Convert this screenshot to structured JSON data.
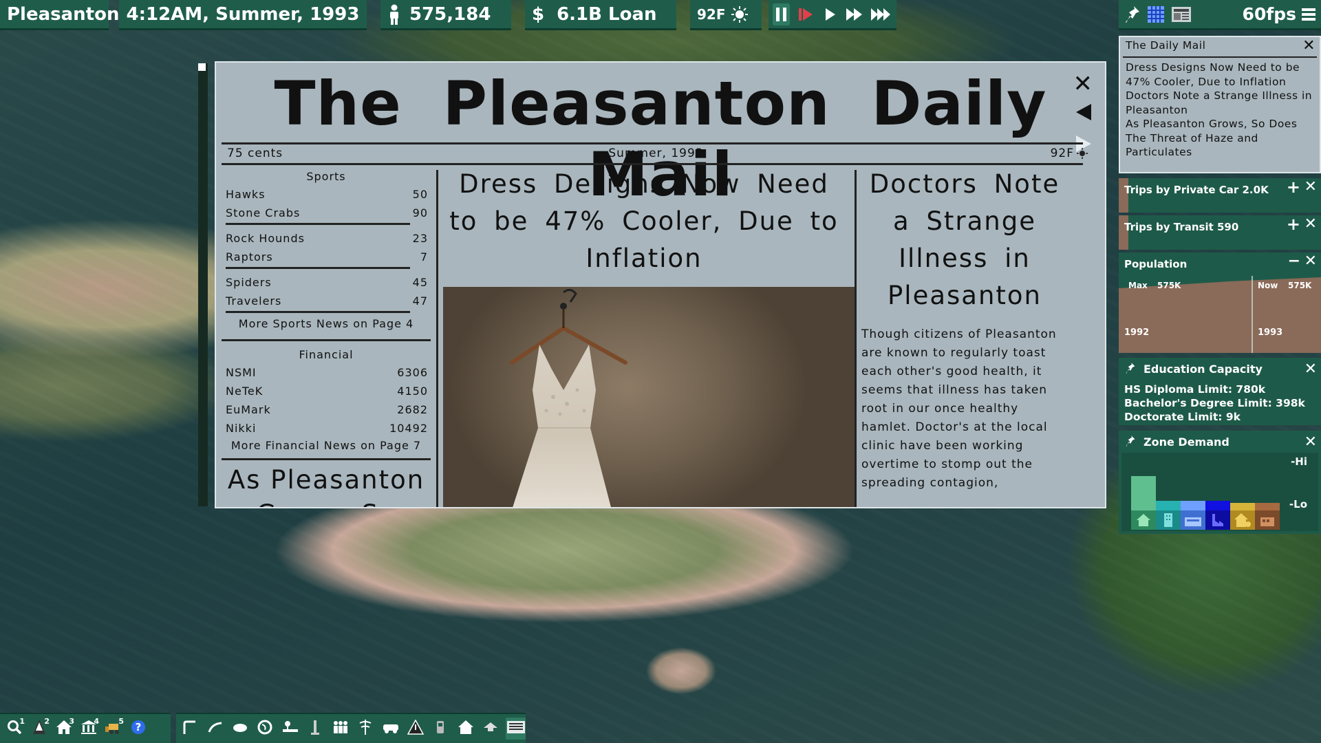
{
  "hud": {
    "city": "Pleasanton",
    "time": "4:12AM, Summer, 1993",
    "population": "575,184",
    "money_symbol": "$",
    "money": "6.1B Loan",
    "temperature": "92F",
    "fps": "60fps"
  },
  "newspaper": {
    "masthead": "The Pleasanton Daily Mail",
    "price": "75 cents",
    "date": "Summer, 1993",
    "temperature": "92F",
    "sports": {
      "title": "Sports",
      "games": [
        {
          "team": "Hawks",
          "score": "50"
        },
        {
          "team": "Stone Crabs",
          "score": "90"
        },
        {
          "team": "Rock Hounds",
          "score": "23"
        },
        {
          "team": "Raptors",
          "score": "7"
        },
        {
          "team": "Spiders",
          "score": "45"
        },
        {
          "team": "Travelers",
          "score": "47"
        }
      ],
      "more": "More Sports News on Page 4"
    },
    "financial": {
      "title": "Financial",
      "stocks": [
        {
          "name": "NSMI",
          "value": "6306"
        },
        {
          "name": "NeTeK",
          "value": "4150"
        },
        {
          "name": "EuMark",
          "value": "2682"
        },
        {
          "name": "Nikki",
          "value": "10492"
        }
      ],
      "more": "More Financial News on Page 7"
    },
    "teaser": "As Pleasanton Grows, So",
    "headline_main": "Dress Designs Now Need to be 47% Cooler, Due to Inflation",
    "headline_right": "Doctors Note a Strange Illness in Pleasanton",
    "story_right": "Though citizens of Pleasanton are known to regularly toast each other's good health, it seems that illness has taken root in our once healthy hamlet. Doctor's at the local clinic have been working overtime to stomp out the spreading contagion,"
  },
  "panels": {
    "mail": {
      "title": "The Daily Mail",
      "items": [
        "Dress Designs Now Need to be 47% Cooler, Due to Inflation",
        "Doctors Note a Strange Illness in Pleasanton",
        "As Pleasanton Grows, So Does The Threat of Haze and Particulates"
      ]
    },
    "trips_car": "Trips by Private Car 2.0K",
    "trips_transit": "Trips by Transit 590",
    "population": {
      "title": "Population",
      "max_label": "Max",
      "max_value": "575K",
      "now_label": "Now",
      "now_value": "575K",
      "year_start": "1992",
      "year_end": "1993"
    },
    "education": {
      "title": "Education Capacity",
      "hs": "HS Diploma Limit: 780k",
      "bachelor": "Bachelor's Degree Limit: 398k",
      "doctorate": "Doctorate Limit: 9k"
    },
    "zone_demand": {
      "title": "Zone Demand",
      "hi": "-Hi",
      "lo": "-Lo",
      "bars": [
        {
          "zone": "residential",
          "color": "#5fbf8f",
          "level": 0.62
        },
        {
          "zone": "retail",
          "color": "#28b1b1",
          "level": 0.18
        },
        {
          "zone": "office",
          "color": "#6fa0ff",
          "level": 0.18
        },
        {
          "zone": "industrial",
          "color": "#1010e0",
          "level": 0.18
        },
        {
          "zone": "farm",
          "color": "#d6b43a",
          "level": 0.14
        },
        {
          "zone": "landfill",
          "color": "#a86a40",
          "level": 0.14
        }
      ]
    }
  },
  "toolbar": {
    "group1": [
      {
        "icon": "search-icon",
        "badge": "1"
      },
      {
        "icon": "road-cone-icon",
        "badge": "2"
      },
      {
        "icon": "house-zone-icon",
        "badge": "3"
      },
      {
        "icon": "government-icon",
        "badge": "4"
      },
      {
        "icon": "bulldozer-icon",
        "badge": "5"
      },
      {
        "icon": "help-icon",
        "badge": ""
      }
    ],
    "group2": [
      "road-icon",
      "rail-icon",
      "power-icon",
      "water-icon",
      "park-icon",
      "monument-icon",
      "education-icon",
      "health-icon",
      "transit-icon",
      "warning-icon",
      "bus-icon",
      "housing-icon",
      "hide-roof-icon",
      "newspaper-icon"
    ]
  },
  "colors": {
    "hud_green": "#1f5d4a",
    "paper_grey": "#a9b6bd",
    "pause_red": "#e0404a"
  }
}
